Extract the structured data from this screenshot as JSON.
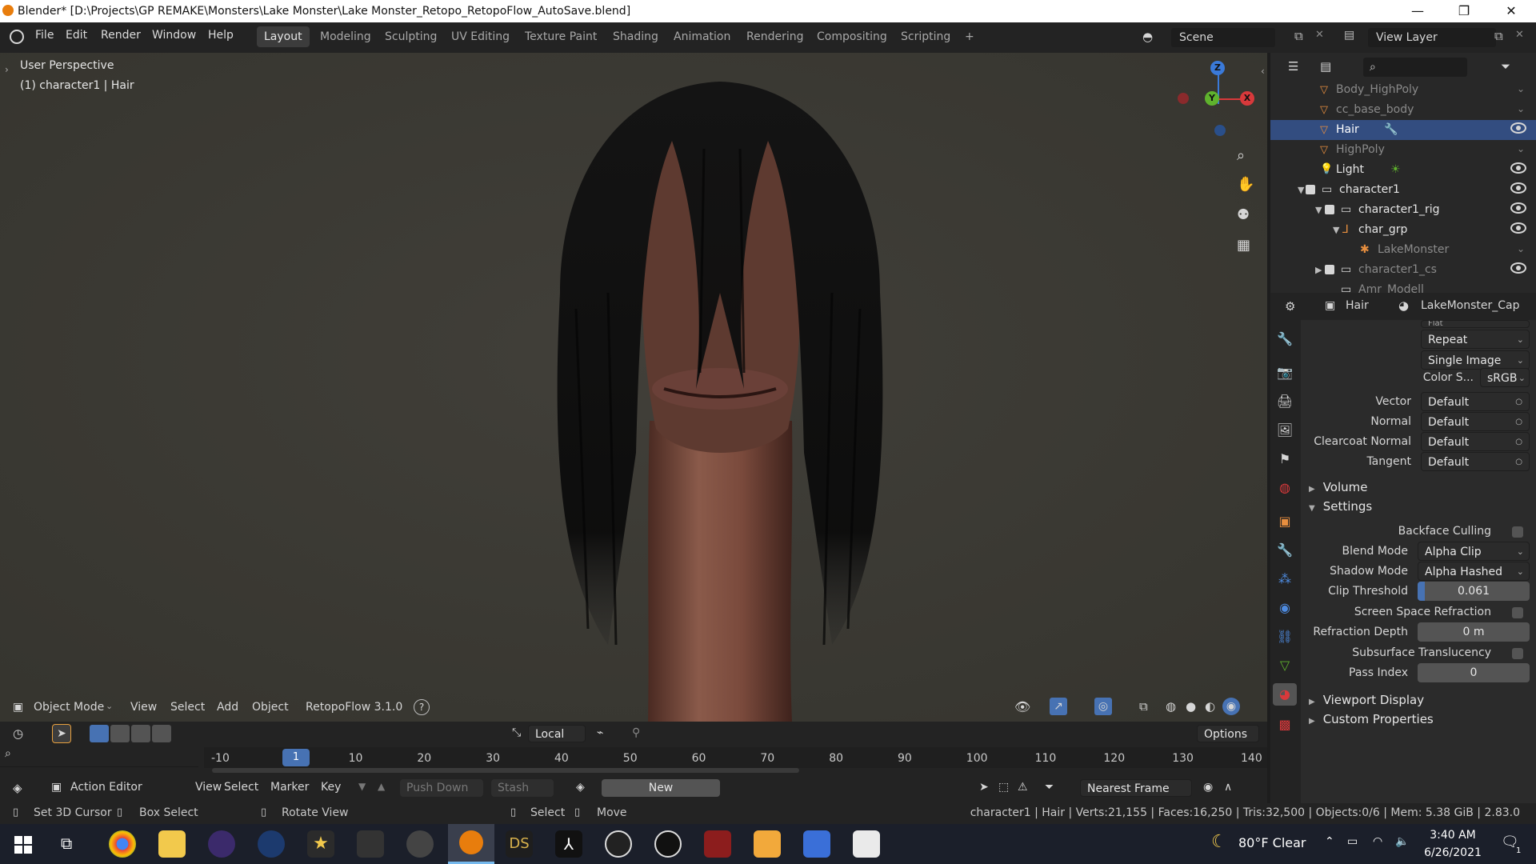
{
  "window": {
    "title": "Blender* [D:\\Projects\\GP REMAKE\\Monsters\\Lake Monster\\Lake Monster_Retopo_RetopoFlow_AutoSave.blend]",
    "controls": [
      "—",
      "❐",
      "✕"
    ]
  },
  "menu": [
    "File",
    "Edit",
    "Render",
    "Window",
    "Help"
  ],
  "workspaces": [
    "Layout",
    "Modeling",
    "Sculpting",
    "UV Editing",
    "Texture Paint",
    "Shading",
    "Animation",
    "Rendering",
    "Compositing",
    "Scripting",
    "+"
  ],
  "active_workspace": "Layout",
  "scene": {
    "label": "Scene"
  },
  "view_layer": {
    "label": "View Layer"
  },
  "viewport": {
    "perspective": "User Perspective",
    "object_info": "(1) character1 | Hair",
    "gizmo": {
      "z": "Z",
      "y": "Y",
      "x": "X"
    },
    "header": {
      "mode": "Object Mode",
      "menus": [
        "View",
        "Select",
        "Add",
        "Object"
      ],
      "addon": "RetopoFlow 3.1.0",
      "help": "?"
    }
  },
  "outliner": {
    "rows": [
      {
        "name": "Body_HighPoly",
        "dim": true
      },
      {
        "name": "cc_base_body",
        "dim": true
      },
      {
        "name": "Hair",
        "dim": false
      },
      {
        "name": "HighPoly",
        "dim": true
      },
      {
        "name": "Light",
        "dim": false
      },
      {
        "name": "character1",
        "dim": false
      },
      {
        "name": "character1_rig",
        "dim": false
      },
      {
        "name": "char_grp",
        "dim": false
      },
      {
        "name": "LakeMonster",
        "dim": true
      },
      {
        "name": "character1_cs",
        "dim": true
      },
      {
        "name": "Amr_Modell",
        "dim": true
      }
    ]
  },
  "properties": {
    "object": "Hair",
    "material": "LakeMonster_Cap",
    "top_partial": "Flat",
    "extension": "Repeat",
    "source": "Single Image",
    "color_space_label": "Color S...",
    "color_space": "sRGB",
    "inputs": [
      {
        "label": "Vector",
        "value": "Default"
      },
      {
        "label": "Normal",
        "value": "Default"
      },
      {
        "label": "Clearcoat Normal",
        "value": "Default"
      },
      {
        "label": "Tangent",
        "value": "Default"
      }
    ],
    "volume": "Volume",
    "settings": "Settings",
    "backface_culling": "Backface Culling",
    "blend_mode_label": "Blend Mode",
    "blend_mode": "Alpha Clip",
    "shadow_mode_label": "Shadow Mode",
    "shadow_mode": "Alpha Hashed",
    "clip_threshold_label": "Clip Threshold",
    "clip_threshold": "0.061",
    "clip_threshold_value": 0.061,
    "ssr": "Screen Space Refraction",
    "refraction_depth_label": "Refraction Depth",
    "refraction_depth": "0 m",
    "subsurface": "Subsurface Translucency",
    "pass_index_label": "Pass Index",
    "pass_index": "0",
    "viewport_display": "Viewport Display",
    "custom_properties": "Custom Properties"
  },
  "timeline": {
    "view_local": "Local",
    "options": "Options",
    "current_frame": "1",
    "ticks": [
      "-10",
      "10",
      "20",
      "30",
      "40",
      "50",
      "60",
      "70",
      "80",
      "90",
      "100",
      "110",
      "120",
      "130",
      "140"
    ],
    "editor": "Action Editor",
    "menus": [
      "View",
      "Select",
      "Marker",
      "Key"
    ],
    "push_down": "Push Down",
    "stash": "Stash",
    "new": "New",
    "snap": "Nearest Frame"
  },
  "status": {
    "left": [
      "Set 3D Cursor",
      "Box Select",
      "Rotate View",
      "Select",
      "Move"
    ],
    "right": "character1 | Hair | Verts:21,155 | Faces:16,250 | Tris:32,500 | Objects:0/6 | Mem: 5.38 GiB | 2.83.0"
  },
  "taskbar": {
    "weather": "80°F  Clear",
    "time": "3:40 AM",
    "date": "6/26/2021",
    "notifications": "1"
  }
}
